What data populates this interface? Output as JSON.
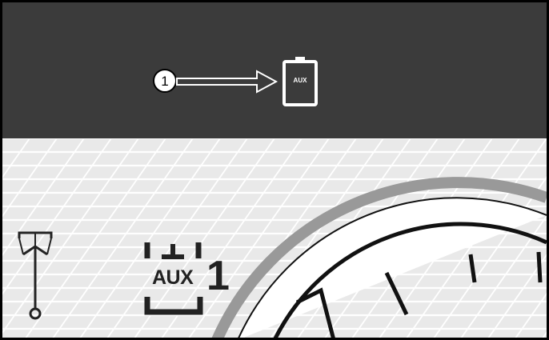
{
  "callout": {
    "number": "1"
  },
  "status_bar": {
    "aux_icon_text": "AUX"
  },
  "aux_indicator": {
    "text": "AUX",
    "number": "1"
  },
  "colors": {
    "status_bar_bg": "#3b3b3b",
    "lower_bg": "#e9e9e9",
    "icon_fg": "#ffffff"
  },
  "icons": [
    "arrow-right-icon",
    "aux-battery-icon",
    "boom-hook-icon",
    "aux-bracket-icon",
    "gauge-dial-icon"
  ]
}
